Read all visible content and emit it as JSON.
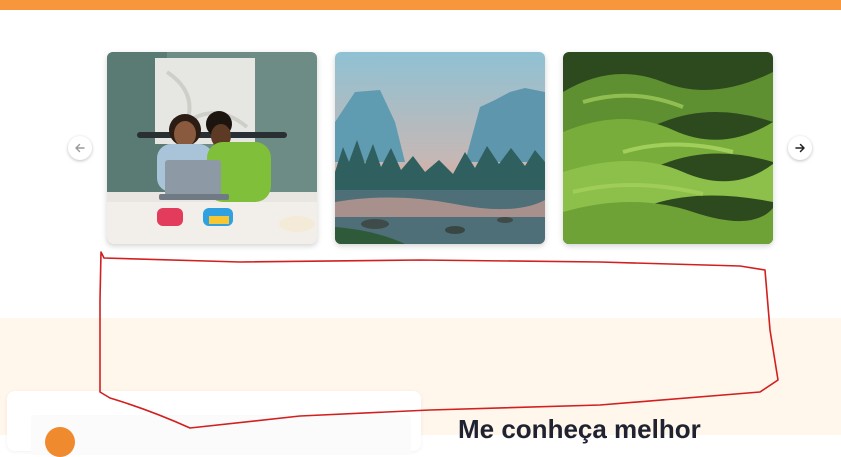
{
  "header": {
    "accent_color": "#f7963a"
  },
  "carousel": {
    "prev_icon": "arrow-left-icon",
    "next_icon": "arrow-right-icon",
    "slides": [
      {
        "subject": "two women on a bed with a laptop"
      },
      {
        "subject": "mountain valley river at sunset"
      },
      {
        "subject": "green rolling hills"
      }
    ]
  },
  "about": {
    "title": "Me conheça melhor",
    "background_color": "#fff6ec",
    "avatar_color": "#f08a2e"
  },
  "annotation": {
    "color": "#d21f1f"
  }
}
